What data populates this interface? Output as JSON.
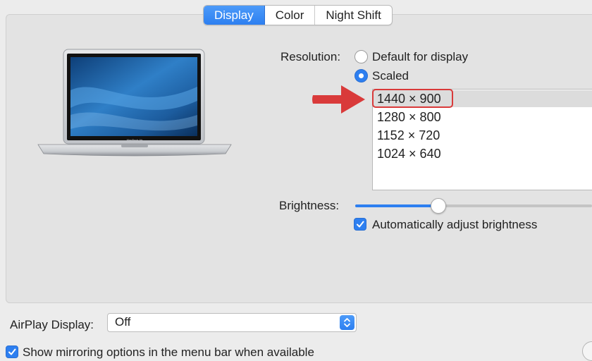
{
  "tabs": [
    {
      "label": "Display",
      "active": true
    },
    {
      "label": "Color",
      "active": false
    },
    {
      "label": "Night Shift",
      "active": false
    }
  ],
  "resolution": {
    "label": "Resolution:",
    "option_default": "Default for display",
    "option_scaled": "Scaled",
    "selected_option": "Scaled"
  },
  "scaled_list": {
    "items": [
      "1440 × 900",
      "1280 × 800",
      "1152 × 720",
      "1024 × 640"
    ],
    "selected": "1440 × 900"
  },
  "brightness": {
    "label": "Brightness:",
    "value": 0.35,
    "auto_adjust_label": "Automatically adjust brightness",
    "auto_adjust_checked": true
  },
  "airplay": {
    "label": "AirPlay Display:",
    "value": "Off"
  },
  "mirroring": {
    "label": "Show mirroring options in the menu bar when available",
    "checked": true
  },
  "laptop": {
    "logo_text": "MacBook Air"
  },
  "colors": {
    "accent": "#2d7ff0",
    "annotation": "#d93a3a"
  },
  "icons": {
    "annotation_arrow": "right-arrow-icon",
    "display_image": "laptop-icon",
    "select_arrows": "updown-chevron-icon"
  }
}
